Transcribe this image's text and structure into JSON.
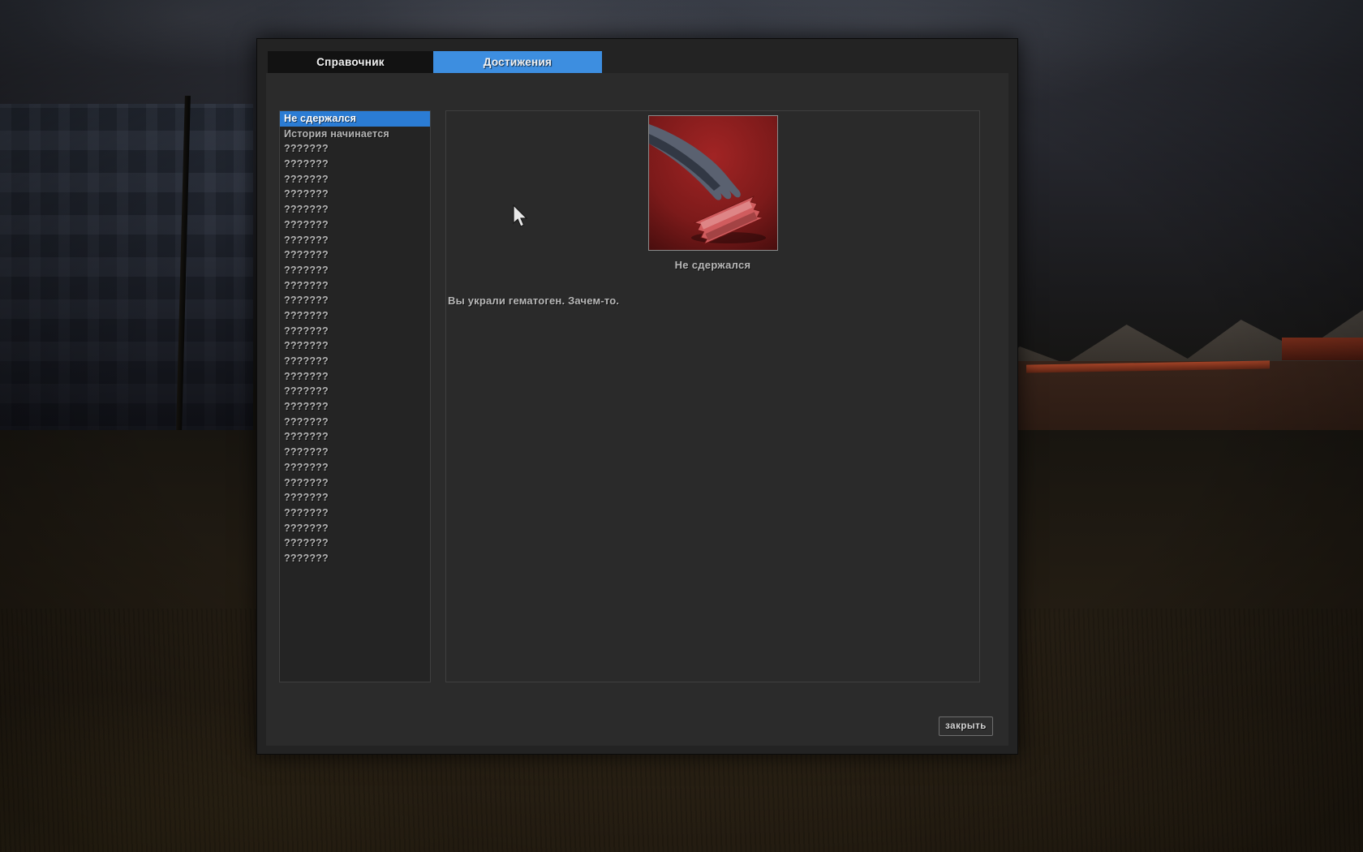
{
  "dialog": {
    "tabs": [
      {
        "label": "Справочник",
        "active": false
      },
      {
        "label": "Достижения",
        "active": true
      }
    ],
    "close_label": "закрыть"
  },
  "achievements": {
    "selected_index": 0,
    "list": [
      "Не сдержался",
      "История начинается",
      "???????",
      "???????",
      "???????",
      "???????",
      "???????",
      "???????",
      "???????",
      "???????",
      "???????",
      "???????",
      "???????",
      "???????",
      "???????",
      "???????",
      "???????",
      "???????",
      "???????",
      "???????",
      "???????",
      "???????",
      "???????",
      "???????",
      "???????",
      "???????",
      "???????",
      "???????",
      "???????",
      "???????"
    ],
    "detail": {
      "title": "Не сдержался",
      "description": "Вы украли гематоген. Зачем-то.",
      "icon": "hand-reaching-hematogen-icon"
    }
  },
  "colors": {
    "tab_active": "#3d8ee0",
    "selection_blue": "#2b7cd4",
    "dialog_bg": "#232323",
    "panel_bg": "#2b2b2b",
    "list_text": "#b4b4b4",
    "icon_red": "#7c1a1a"
  }
}
